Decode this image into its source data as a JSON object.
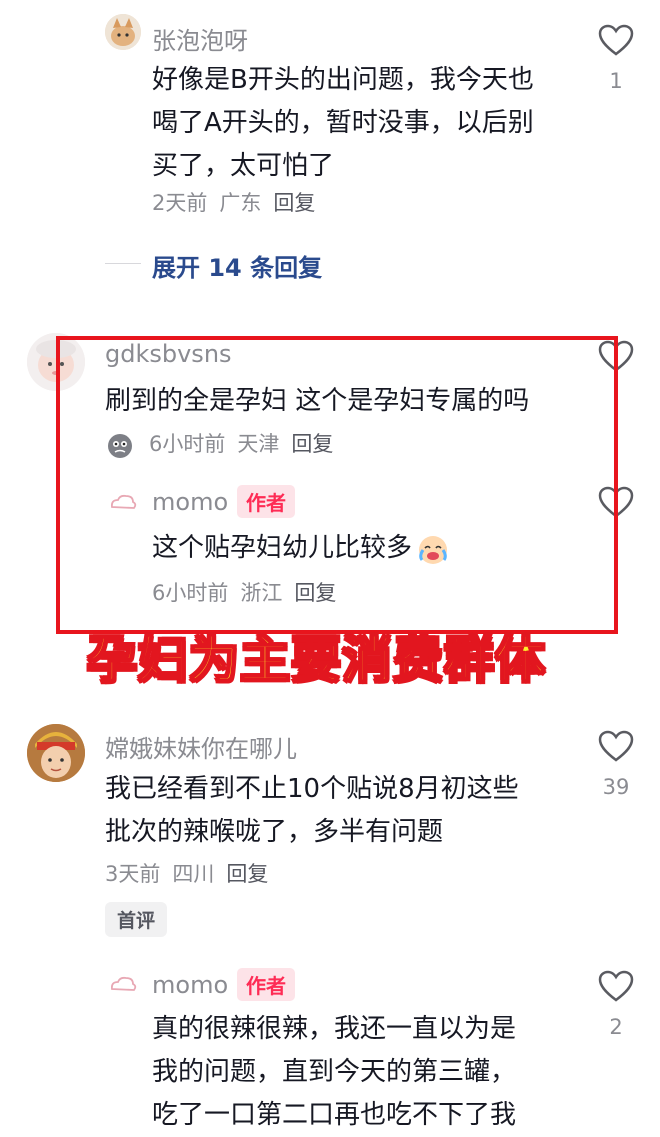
{
  "comments": [
    {
      "username": "张泡泡呀",
      "lines": [
        "好像是B开头的出问题，我今天也",
        "喝了A开头的，暂时没事，以后别",
        "买了，太可怕了"
      ],
      "time": "2天前",
      "location": "广东",
      "reply_label": "回复",
      "likes": "1",
      "expand_label": "展开 14 条回复"
    },
    {
      "username": "gdksbvsns",
      "lines": [
        "刷到的全是孕妇 这个是孕妇专属的吗"
      ],
      "time": "6小时前",
      "location": "天津",
      "reply_label": "回复",
      "reply": {
        "username": "momo",
        "author_tag": "作者",
        "text": "这个贴孕妇幼儿比较多",
        "time": "6小时前",
        "location": "浙江",
        "reply_label": "回复"
      }
    },
    {
      "username": "嫦娥妹妹你在哪儿",
      "lines": [
        "我已经看到不止10个贴说8月初这些",
        "批次的辣喉咙了，多半有问题"
      ],
      "time": "3天前",
      "location": "四川",
      "reply_label": "回复",
      "likes": "39",
      "badge": "首评",
      "reply": {
        "username": "momo",
        "author_tag": "作者",
        "lines": [
          "真的很辣很辣，我还一直以为是",
          "我的问题，直到今天的第三罐，",
          "吃了一口第二口再也吃不下了我"
        ],
        "likes": "2"
      }
    }
  ],
  "overlay_caption": "孕妇为主要消费群体",
  "colors": {
    "highlight_box": "#e8151d",
    "caption_fill": "#ffee2b",
    "caption_outline": "#e2161f",
    "author_tag": "#fe2c55",
    "expand_link": "#2a4a8d"
  }
}
